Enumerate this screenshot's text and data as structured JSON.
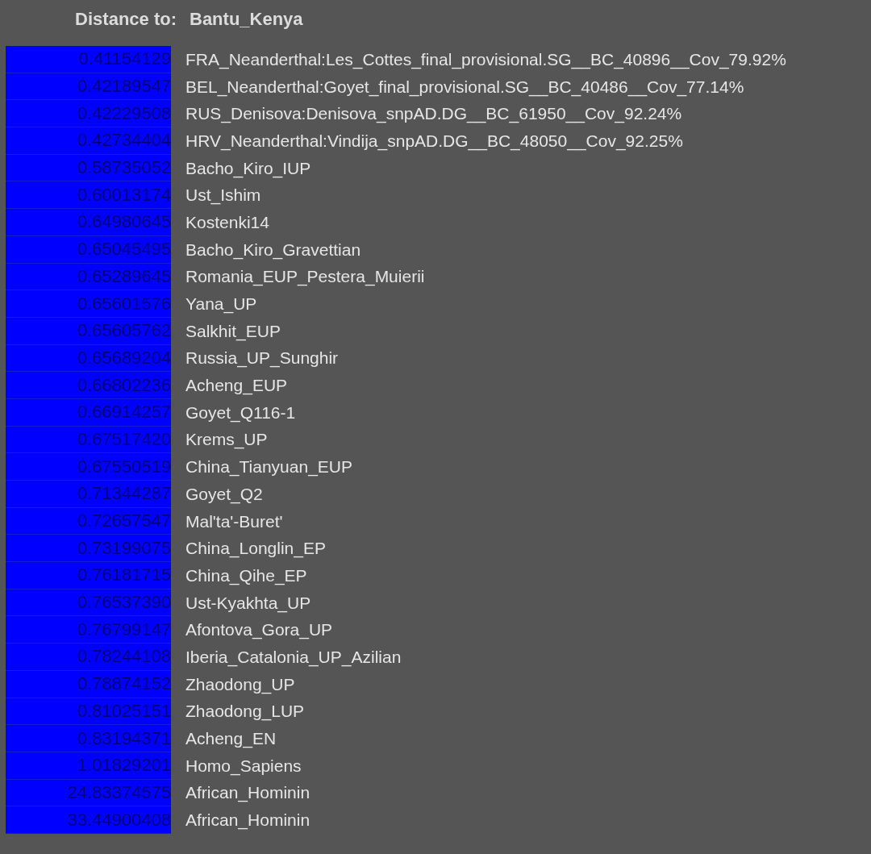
{
  "header": {
    "label": "Distance to:",
    "target": "Bantu_Kenya"
  },
  "rows": [
    {
      "distance": "0.41154129",
      "name": "FRA_Neanderthal:Les_Cottes_final_provisional.SG__BC_40896__Cov_79.92%"
    },
    {
      "distance": "0.42189547",
      "name": "BEL_Neanderthal:Goyet_final_provisional.SG__BC_40486__Cov_77.14%"
    },
    {
      "distance": "0.42229508",
      "name": "RUS_Denisova:Denisova_snpAD.DG__BC_61950__Cov_92.24%"
    },
    {
      "distance": "0.42734404",
      "name": "HRV_Neanderthal:Vindija_snpAD.DG__BC_48050__Cov_92.25%"
    },
    {
      "distance": "0.58735052",
      "name": "Bacho_Kiro_IUP"
    },
    {
      "distance": "0.60013174",
      "name": "Ust_Ishim"
    },
    {
      "distance": "0.64980645",
      "name": "Kostenki14"
    },
    {
      "distance": "0.65045495",
      "name": "Bacho_Kiro_Gravettian"
    },
    {
      "distance": "0.65289645",
      "name": "Romania_EUP_Pestera_Muierii"
    },
    {
      "distance": "0.65601576",
      "name": "Yana_UP"
    },
    {
      "distance": "0.65605762",
      "name": "Salkhit_EUP"
    },
    {
      "distance": "0.65689204",
      "name": "Russia_UP_Sunghir"
    },
    {
      "distance": "0.66802236",
      "name": "Acheng_EUP"
    },
    {
      "distance": "0.66914257",
      "name": "Goyet_Q116-1"
    },
    {
      "distance": "0.67517420",
      "name": "Krems_UP"
    },
    {
      "distance": "0.67550519",
      "name": "China_Tianyuan_EUP"
    },
    {
      "distance": "0.71344287",
      "name": "Goyet_Q2"
    },
    {
      "distance": "0.72657547",
      "name": "Mal'ta'-Buret'"
    },
    {
      "distance": "0.73199075",
      "name": "China_Longlin_EP"
    },
    {
      "distance": "0.76181715",
      "name": "China_Qihe_EP"
    },
    {
      "distance": "0.76537390",
      "name": "Ust-Kyakhta_UP"
    },
    {
      "distance": "0.76799147",
      "name": "Afontova_Gora_UP"
    },
    {
      "distance": "0.78244108",
      "name": "Iberia_Catalonia_UP_Azilian"
    },
    {
      "distance": "0.78874152",
      "name": "Zhaodong_UP"
    },
    {
      "distance": "0.81025151",
      "name": "Zhaodong_LUP"
    },
    {
      "distance": "0.83194371",
      "name": "Acheng_EN"
    },
    {
      "distance": "1.01829201",
      "name": "Homo_Sapiens"
    },
    {
      "distance": "24.83374575",
      "name": "African_Hominin"
    },
    {
      "distance": "33.44900408",
      "name": "African_Hominin"
    }
  ]
}
